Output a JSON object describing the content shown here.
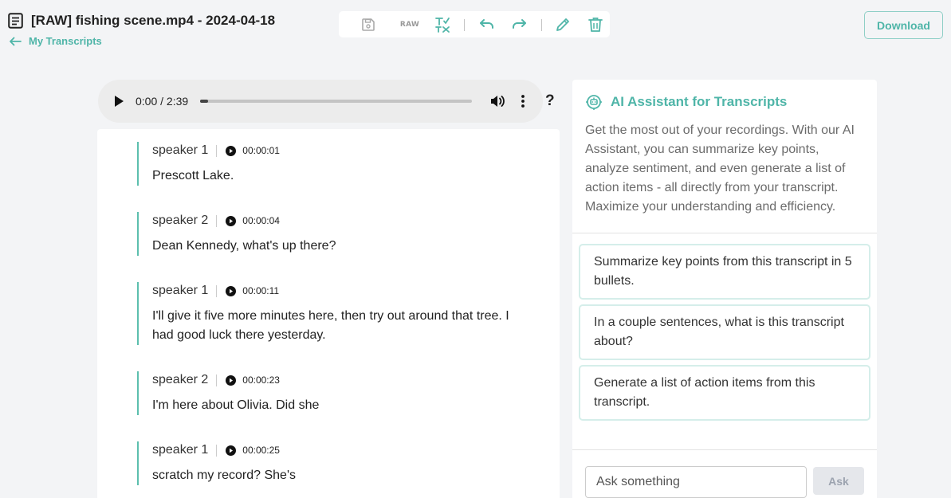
{
  "header": {
    "title": "[RAW] fishing scene.mp4 - 2024-04-18",
    "back_link": "My Transcripts",
    "download_label": "Download"
  },
  "toolbar": {
    "raw_label": "RAW",
    "icons": [
      "save-icon",
      "raw-icon",
      "find-replace-icon",
      "undo-icon",
      "redo-icon",
      "edit-icon",
      "delete-icon"
    ]
  },
  "audio": {
    "time": "0:00 / 2:39",
    "progress": 0.03
  },
  "help_label": "?",
  "transcript": {
    "segments": [
      {
        "speaker": "speaker 1",
        "time": "00:00:01",
        "text": "Prescott Lake."
      },
      {
        "speaker": "speaker 2",
        "time": "00:00:04",
        "text": "Dean Kennedy, what's up there?"
      },
      {
        "speaker": "speaker 1",
        "time": "00:00:11",
        "text": "I'll give it five more minutes here, then try out around that tree. I had good luck there yesterday."
      },
      {
        "speaker": "speaker 2",
        "time": "00:00:23",
        "text": "I'm here about Olivia. Did she"
      },
      {
        "speaker": "speaker 1",
        "time": "00:00:25",
        "text": "scratch my record? She's"
      }
    ]
  },
  "ai": {
    "title": "AI Assistant for Transcripts",
    "description": "Get the most out of your recordings. With our AI Assistant, you can summarize key points, analyze sentiment, and even generate a list of action items - all directly from your transcript. Maximize your understanding and efficiency.",
    "suggestions": [
      "Summarize key points from this transcript in 5 bullets.",
      "In a couple sentences, what is this transcript about?",
      "Generate a list of action items from this transcript."
    ],
    "ask_placeholder": "Ask something",
    "ask_label": "Ask"
  },
  "colors": {
    "accent": "#4fb5a8",
    "segment_border": "#5cbfae",
    "background": "#f3f4f6"
  }
}
